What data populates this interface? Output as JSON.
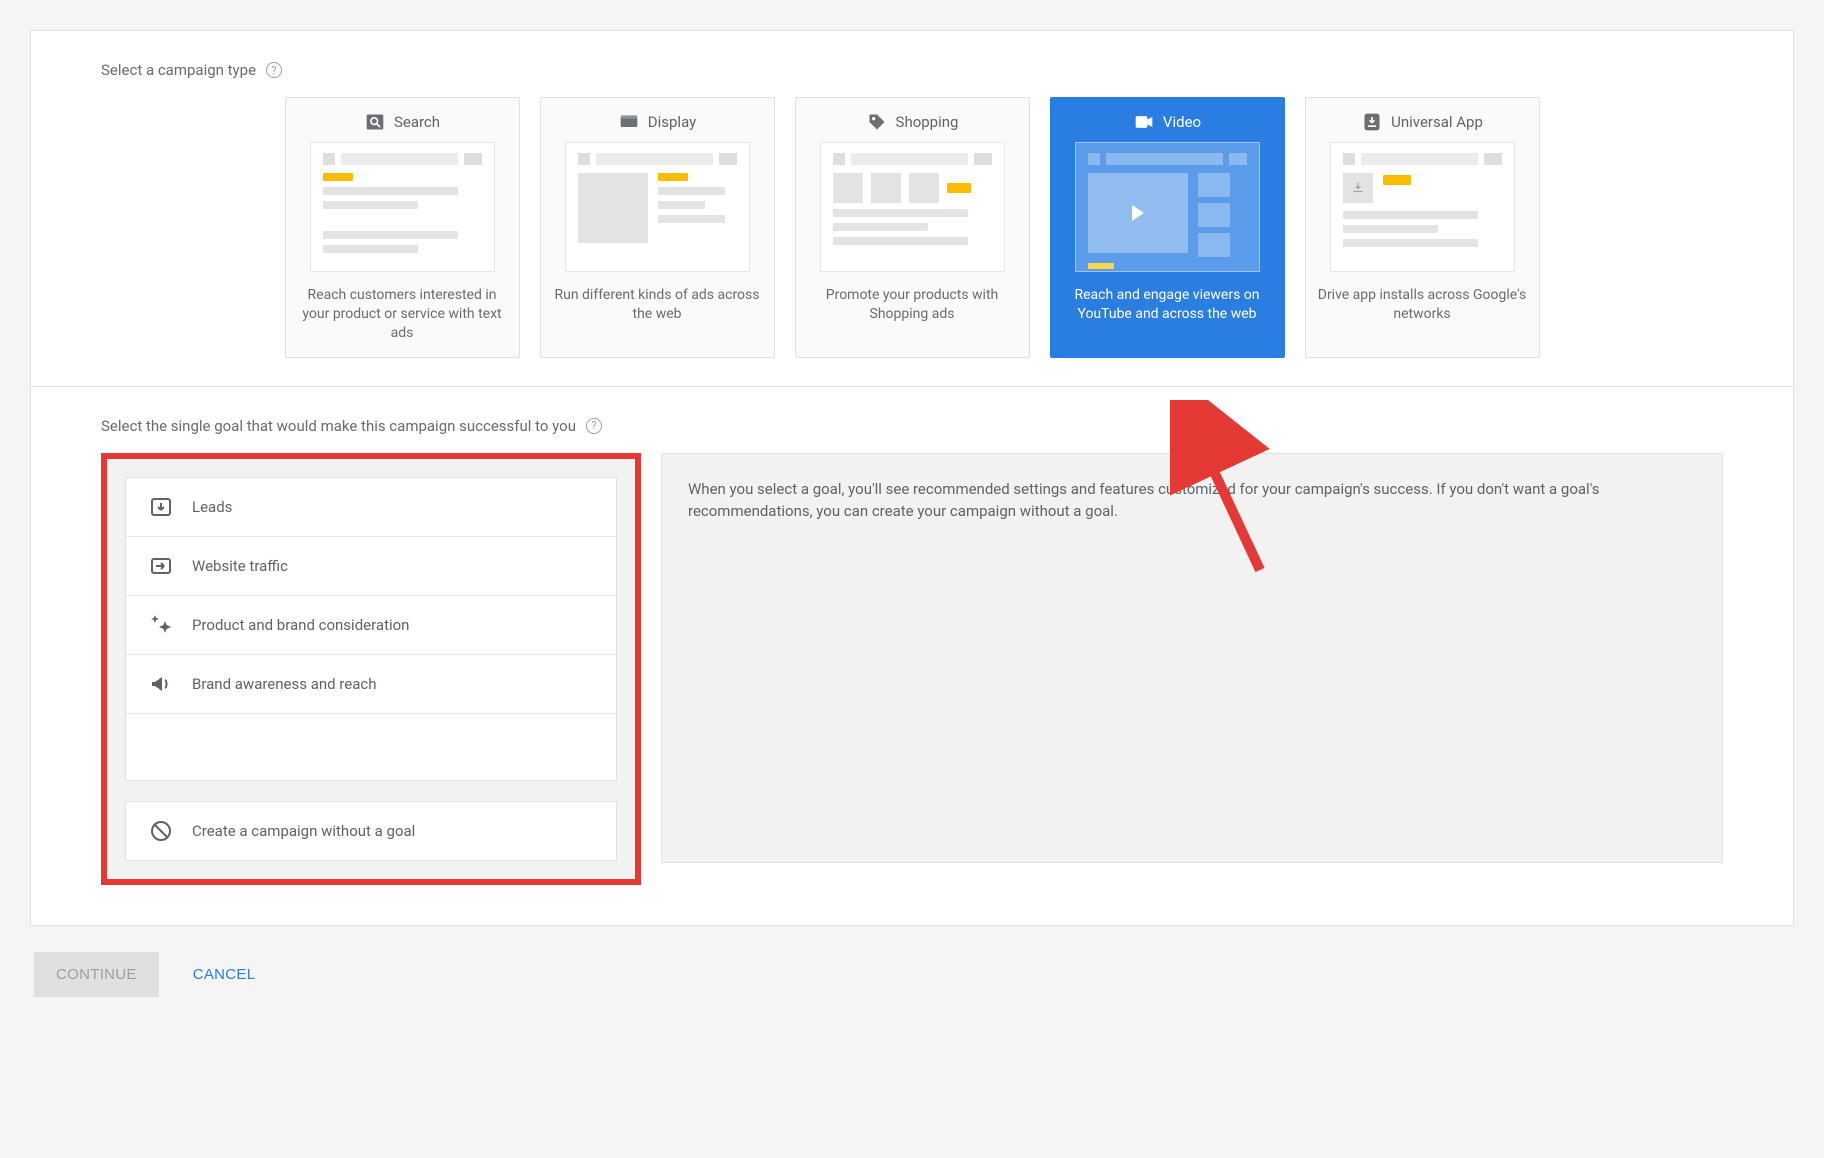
{
  "section_campaign_type": {
    "label": "Select a campaign type"
  },
  "campaign_types": [
    {
      "title": "Search",
      "desc": "Reach customers interested in your product or service with text ads",
      "icon": "search"
    },
    {
      "title": "Display",
      "desc": "Run different kinds of ads across the web",
      "icon": "display"
    },
    {
      "title": "Shopping",
      "desc": "Promote your products with Shopping ads",
      "icon": "shopping"
    },
    {
      "title": "Video",
      "desc": "Reach and engage viewers on YouTube and across the web",
      "icon": "video",
      "selected": true
    },
    {
      "title": "Universal App",
      "desc": "Drive app installs across Google's networks",
      "icon": "app"
    }
  ],
  "section_goal": {
    "label": "Select the single goal that would make this campaign successful to you",
    "explain": "When you select a goal, you'll see recommended settings and features customized for your campaign's success. If you don't want a goal's recommendations, you can create your campaign without a goal."
  },
  "goals": [
    {
      "label": "Leads",
      "icon": "leads"
    },
    {
      "label": "Website traffic",
      "icon": "traffic"
    },
    {
      "label": "Product and brand consideration",
      "icon": "sparkle"
    },
    {
      "label": "Brand awareness and reach",
      "icon": "megaphone"
    }
  ],
  "goal_none": {
    "label": "Create a campaign without a goal",
    "icon": "no-sign"
  },
  "buttons": {
    "continue": "CONTINUE",
    "cancel": "CANCEL"
  }
}
